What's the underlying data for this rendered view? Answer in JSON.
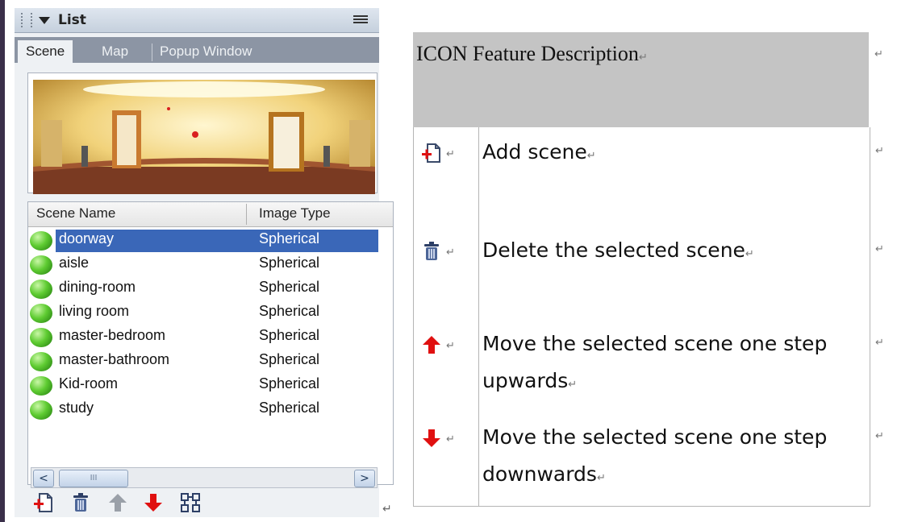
{
  "panel": {
    "title": "List",
    "tabs": [
      "Scene",
      "Map",
      "Popup Window"
    ],
    "active_tab": "Scene",
    "columns": [
      "Scene Name",
      "Image Type"
    ],
    "rows": [
      {
        "name": "doorway",
        "type": "Spherical",
        "selected": true
      },
      {
        "name": "aisle",
        "type": "Spherical",
        "selected": false
      },
      {
        "name": "dining-room",
        "type": "Spherical",
        "selected": false
      },
      {
        "name": "living room",
        "type": "Spherical",
        "selected": false
      },
      {
        "name": "master-bedroom",
        "type": "Spherical",
        "selected": false
      },
      {
        "name": "master-bathroom",
        "type": "Spherical",
        "selected": false
      },
      {
        "name": "Kid-room",
        "type": "Spherical",
        "selected": false
      },
      {
        "name": "study",
        "type": "Spherical",
        "selected": false
      }
    ],
    "scroll_left": "<",
    "scroll_right": ">",
    "scroll_thumb": "III",
    "toolbar_icons": [
      "add-scene-icon",
      "delete-scene-icon",
      "move-up-icon",
      "move-down-icon",
      "arrange-icon"
    ]
  },
  "table": {
    "header": "ICON Feature Description",
    "return_mark": "↵",
    "rows": [
      {
        "icon": "add-scene-icon",
        "description": "Add scene"
      },
      {
        "icon": "delete-scene-icon",
        "description": "Delete the selected scene"
      },
      {
        "icon": "move-up-icon",
        "description": "Move the selected scene one step upwards"
      },
      {
        "icon": "move-down-icon",
        "description": "Move the selected scene one step downwards"
      }
    ]
  },
  "colors": {
    "selection": "#3a67b8",
    "tab_bar": "#8c95a4",
    "table_header": "#c4c4c4",
    "arrow_red": "#e01010",
    "frame": "#3a2f4a"
  }
}
